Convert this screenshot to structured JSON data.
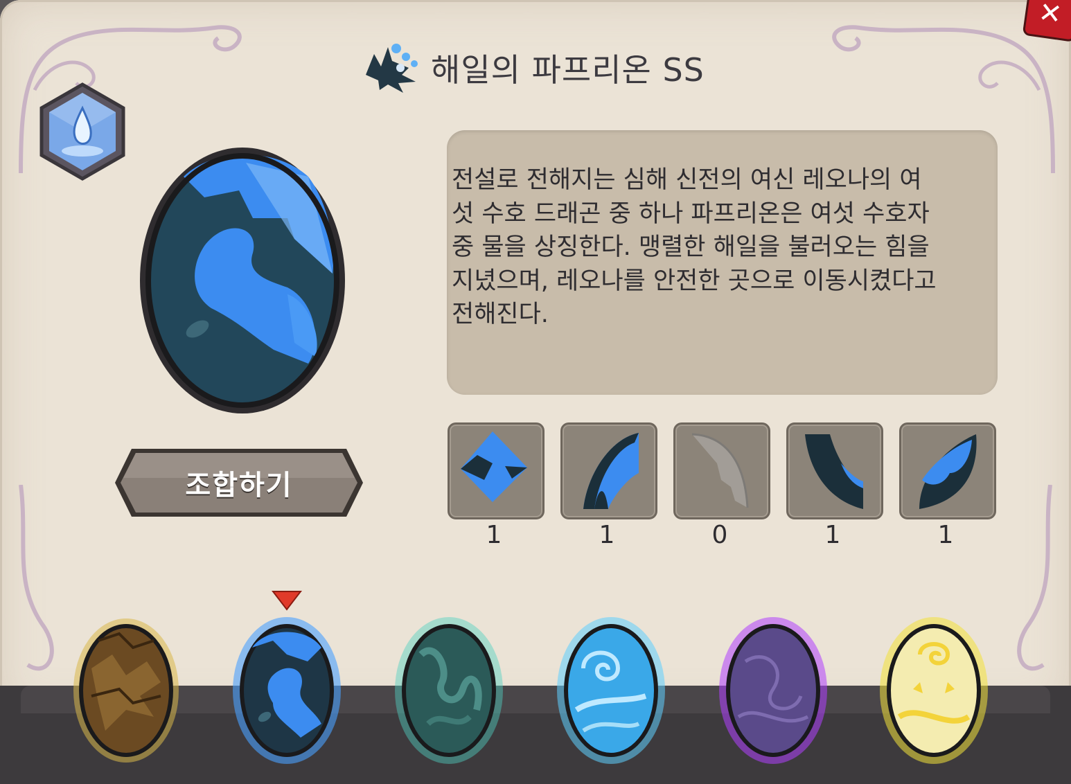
{
  "dialog": {
    "title": "해일의 파프리온 SS",
    "close_label": "✕",
    "description": "전설로 전해지는 심해 신전의 여신 레오나의 여\n섯 수호 드래곤 중 하나 파프리온은 여섯 수호자\n중 물을 상징한다. 맹렬한 해일을 불러오는 힘을\n지녔으며, 레오나를 안전한 곳으로 이동시켰다고\n전해진다.",
    "combine_button": "조합하기",
    "element_icon": "water-drop-icon"
  },
  "pieces": [
    {
      "name": "egg-piece-center",
      "count": "1",
      "owned": true
    },
    {
      "name": "egg-piece-top-left",
      "count": "1",
      "owned": true
    },
    {
      "name": "egg-piece-top-right",
      "count": "0",
      "owned": false
    },
    {
      "name": "egg-piece-bottom-left",
      "count": "1",
      "owned": true
    },
    {
      "name": "egg-piece-bottom-right",
      "count": "1",
      "owned": true
    }
  ],
  "eggs": [
    {
      "name": "earth-egg",
      "glow": "#d9b84a",
      "base": "#6b4a22",
      "selected": false
    },
    {
      "name": "water-egg",
      "glow": "#4aa0ff",
      "base": "#1e3646",
      "selected": true
    },
    {
      "name": "wind-egg",
      "glow": "#4fd1c0",
      "base": "#2b5a58",
      "selected": false
    },
    {
      "name": "ice-egg",
      "glow": "#5fd0ff",
      "base": "#3aa8e8",
      "selected": false
    },
    {
      "name": "dark-egg",
      "glow": "#b040ff",
      "base": "#5a4a8a",
      "selected": false
    },
    {
      "name": "light-egg",
      "glow": "#f2e23a",
      "base": "#f4ecb0",
      "selected": false
    }
  ],
  "colors": {
    "panel": "#ebe3d6",
    "desc_box": "#c8bcaa",
    "accent_blue": "#3c8cf0",
    "selector_red": "#e03a2a"
  }
}
